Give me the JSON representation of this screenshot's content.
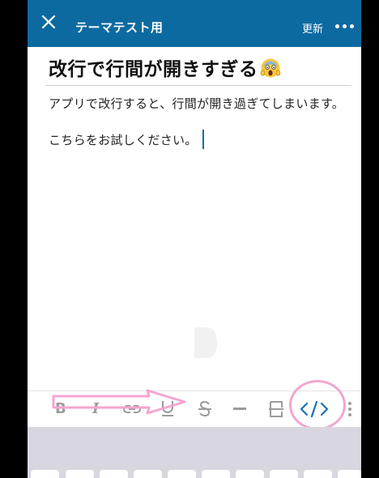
{
  "header": {
    "title": "テーマテスト用",
    "update_label": "更新"
  },
  "editor": {
    "heading": "改行で行間が開きすぎる",
    "heading_emoji": "face-screaming-in-fear-emoji",
    "paragraph1": "アプリで改行すると、行間が開き過ぎてしまいます。",
    "paragraph2": "こちらをお試しください。"
  },
  "toolbar": {
    "items": [
      "bold-icon",
      "italic-icon",
      "link-icon",
      "underline-icon",
      "strikethrough-icon",
      "divider-icon",
      "block-icon",
      "code-icon",
      "more-vertical-icon"
    ]
  },
  "annotations": {
    "arrow_color": "#f3a6cf",
    "circle_color": "#f3a6cf"
  },
  "colors": {
    "header_bg": "#0d6aa0",
    "toolbar_icon": "#9b9b9b",
    "accent": "#0d6aa0"
  }
}
